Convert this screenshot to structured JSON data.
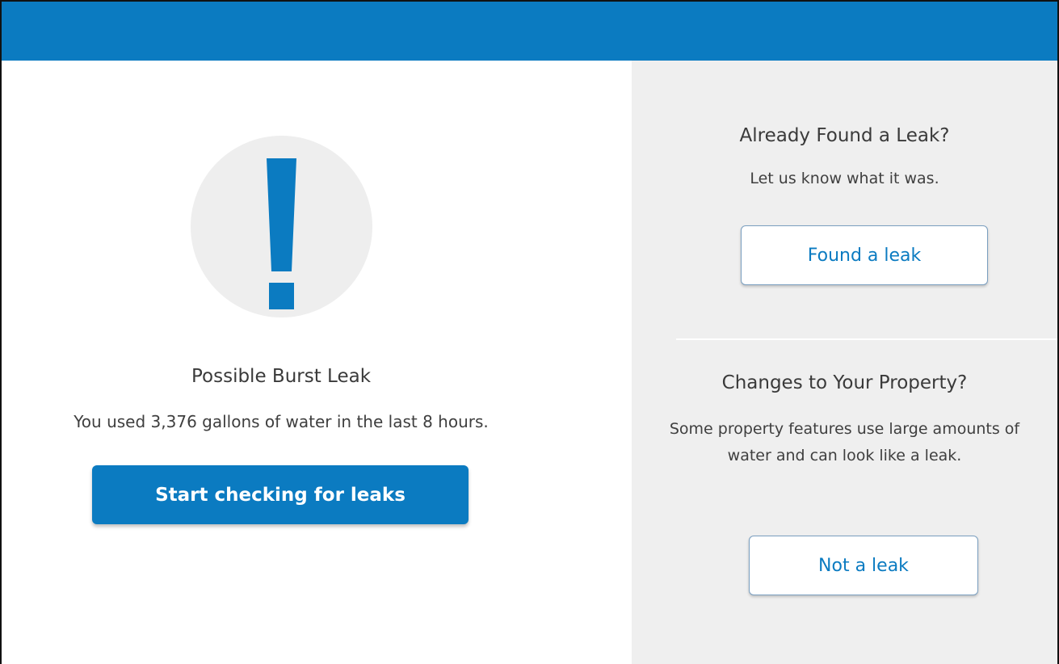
{
  "colors": {
    "accent": "#0b7bc1",
    "panel_bg": "#efefef",
    "circle_bg": "#eeeeee"
  },
  "alert": {
    "icon": "exclamation-icon",
    "title": "Possible Burst Leak",
    "description": "You used 3,376 gallons of water in the last 8 hours.",
    "button_label": "Start checking for leaks"
  },
  "found_section": {
    "title": "Already Found a Leak?",
    "text": "Let us know what it was.",
    "button_label": "Found a leak"
  },
  "changes_section": {
    "title": "Changes to Your Property?",
    "text": "Some property features use large amounts of water and can look like a leak.",
    "button_label": "Not a leak"
  }
}
